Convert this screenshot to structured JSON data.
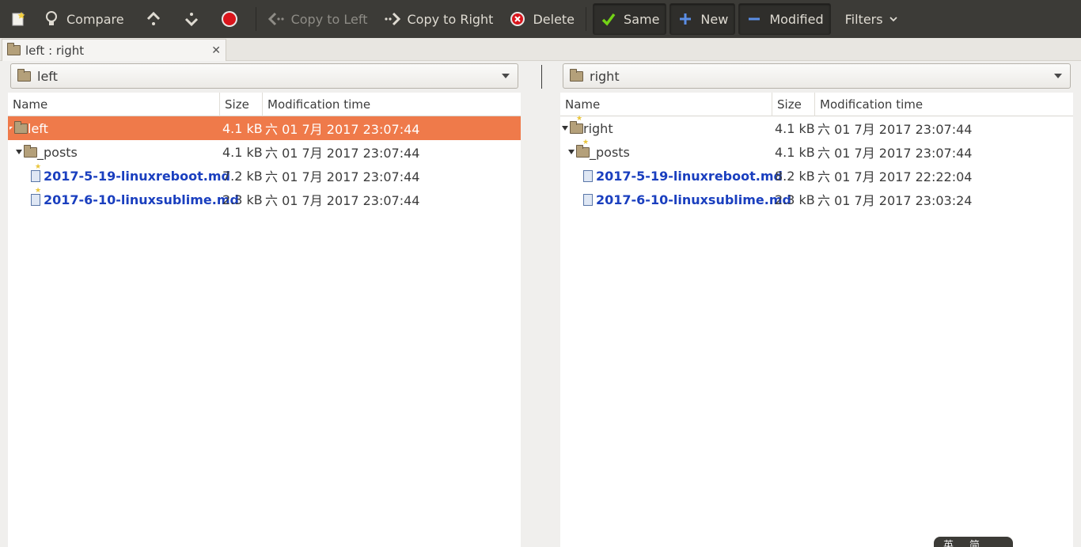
{
  "toolbar": {
    "compare_label": "Compare",
    "copy_left_label": "Copy to Left",
    "copy_right_label": "Copy to Right",
    "delete_label": "Delete",
    "same_label": "Same",
    "new_label": "New",
    "modified_label": "Modified",
    "filters_label": "Filters"
  },
  "tab": {
    "label": "left : right"
  },
  "left": {
    "path": "left",
    "headers": {
      "name": "Name",
      "size": "Size",
      "mtime": "Modification time"
    },
    "rows": [
      {
        "name": "left",
        "size": "4.1 kB",
        "mtime": "六 01 7月 2017 23:07:44"
      },
      {
        "name": "_posts",
        "size": "4.1 kB",
        "mtime": "六 01 7月 2017 23:07:44"
      },
      {
        "name": "2017-5-19-linuxreboot.md",
        "size": "7.2 kB",
        "mtime": "六 01 7月 2017 23:07:44"
      },
      {
        "name": "2017-6-10-linuxsublime.md",
        "size": "2.3 kB",
        "mtime": "六 01 7月 2017 23:07:44"
      }
    ]
  },
  "right": {
    "path": "right",
    "headers": {
      "name": "Name",
      "size": "Size",
      "mtime": "Modification time"
    },
    "rows": [
      {
        "name": "right",
        "size": "4.1 kB",
        "mtime": "六 01 7月 2017 23:07:44"
      },
      {
        "name": "_posts",
        "size": "4.1 kB",
        "mtime": "六 01 7月 2017 23:07:44"
      },
      {
        "name": "2017-5-19-linuxreboot.md",
        "size": "8.2 kB",
        "mtime": "六 01 7月 2017 22:22:04"
      },
      {
        "name": "2017-6-10-linuxsublime.md",
        "size": "2.3 kB",
        "mtime": "六 01 7月 2017 23:03:24"
      }
    ]
  },
  "ime": {
    "left": "英",
    "right": "简"
  },
  "colors": {
    "selected_row": "#ef7a4a",
    "file_link": "#1a3fbf",
    "toolbar_bg": "#3c3b37"
  }
}
